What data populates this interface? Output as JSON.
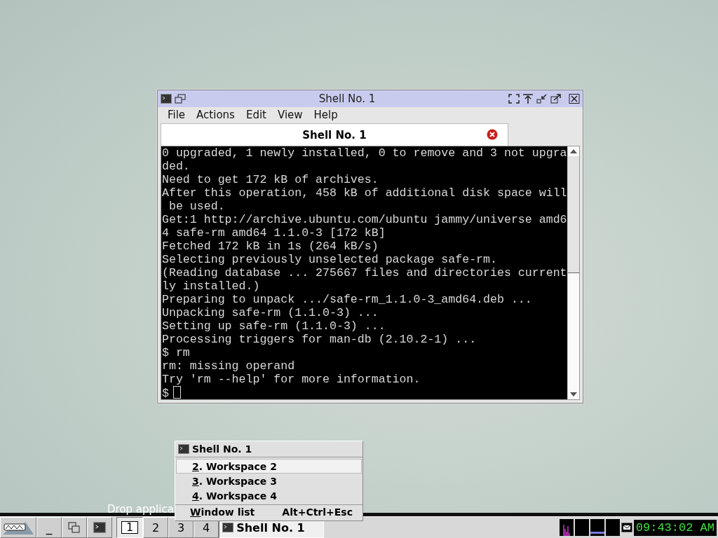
{
  "window": {
    "title": "Shell No. 1",
    "menu": [
      "File",
      "Actions",
      "Edit",
      "View",
      "Help"
    ],
    "tab": {
      "label": "Shell No. 1",
      "selected": true
    },
    "terminal_lines": [
      "0 upgraded, 1 newly installed, 0 to remove and 3 not upgra",
      "ded.",
      "Need to get 172 kB of archives.",
      "After this operation, 458 kB of additional disk space will",
      " be used.",
      "Get:1 http://archive.ubuntu.com/ubuntu jammy/universe amd6",
      "4 safe-rm amd64 1.1.0-3 [172 kB]",
      "Fetched 172 kB in 1s (264 kB/s)",
      "Selecting previously unselected package safe-rm.",
      "(Reading database ... 275667 files and directories current",
      "ly installed.)",
      "Preparing to unpack .../safe-rm_1.1.0-3_amd64.deb ...",
      "Unpacking safe-rm (1.1.0-3) ...",
      "Setting up safe-rm (1.1.0-3) ...",
      "Processing triggers for man-db (2.10.2-1) ...",
      "$ rm",
      "rm: missing operand",
      "Try 'rm --help' for more information."
    ],
    "prompt": "$"
  },
  "popup_menu": {
    "title": "Shell No. 1",
    "items": [
      {
        "key": "2",
        "rest": ". Workspace  2",
        "selected": true
      },
      {
        "key": "3",
        "rest": ". Workspace  3",
        "selected": false
      },
      {
        "key": "4",
        "rest": ". Workspace  4",
        "selected": false
      }
    ],
    "footer": {
      "key": "W",
      "rest": "indow list",
      "shortcut": "Alt+Ctrl+Esc"
    }
  },
  "hint": "Drop applica",
  "taskbar": {
    "show_desktop": "_",
    "workspaces": [
      {
        "label": "1",
        "selected": true
      },
      {
        "label": "2",
        "selected": false
      },
      {
        "label": "3",
        "selected": false
      },
      {
        "label": "4",
        "selected": false
      }
    ],
    "task": {
      "label": "Shell No. 1",
      "selected": true
    },
    "clock": "09:43:02 AM"
  }
}
